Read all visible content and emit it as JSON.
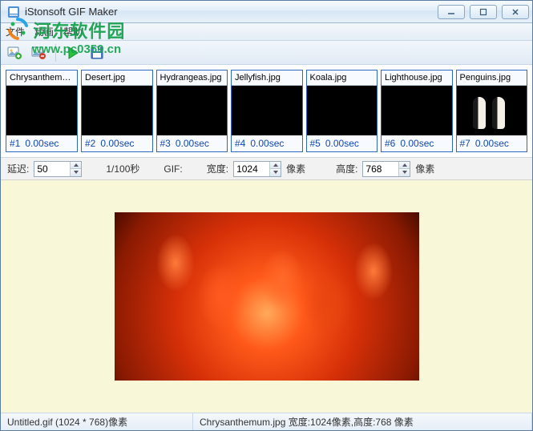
{
  "window": {
    "title": "iStonsoft GIF Maker"
  },
  "watermark": {
    "text": "河东软件园",
    "url": "www.pc0359.cn"
  },
  "menu": {
    "file": "文件",
    "anim": "动画",
    "help": "帮助"
  },
  "frames": [
    {
      "name": "Chrysanthemum",
      "idx": "#1",
      "sec": "0.00sec",
      "cls": "th-chrys"
    },
    {
      "name": "Desert.jpg",
      "idx": "#2",
      "sec": "0.00sec",
      "cls": "th-desert"
    },
    {
      "name": "Hydrangeas.jpg",
      "idx": "#3",
      "sec": "0.00sec",
      "cls": "th-hydra"
    },
    {
      "name": "Jellyfish.jpg",
      "idx": "#4",
      "sec": "0.00sec",
      "cls": "th-jelly"
    },
    {
      "name": "Koala.jpg",
      "idx": "#5",
      "sec": "0.00sec",
      "cls": "th-koala"
    },
    {
      "name": "Lighthouse.jpg",
      "idx": "#6",
      "sec": "0.00sec",
      "cls": "th-light"
    },
    {
      "name": "Penguins.jpg",
      "idx": "#7",
      "sec": "0.00sec",
      "cls": "th-peng"
    }
  ],
  "controls": {
    "delay_label": "延迟:",
    "delay_value": "50",
    "unit": "1/100秒",
    "gif_label": "GIF:",
    "width_label": "宽度:",
    "width_value": "1024",
    "px1": "像素",
    "height_label": "高度:",
    "height_value": "768",
    "px2": "像素"
  },
  "status": {
    "left": "Untitled.gif (1024 * 768)像素",
    "right": "Chrysanthemum.jpg 宽度:1024像素,高度:768 像素"
  }
}
